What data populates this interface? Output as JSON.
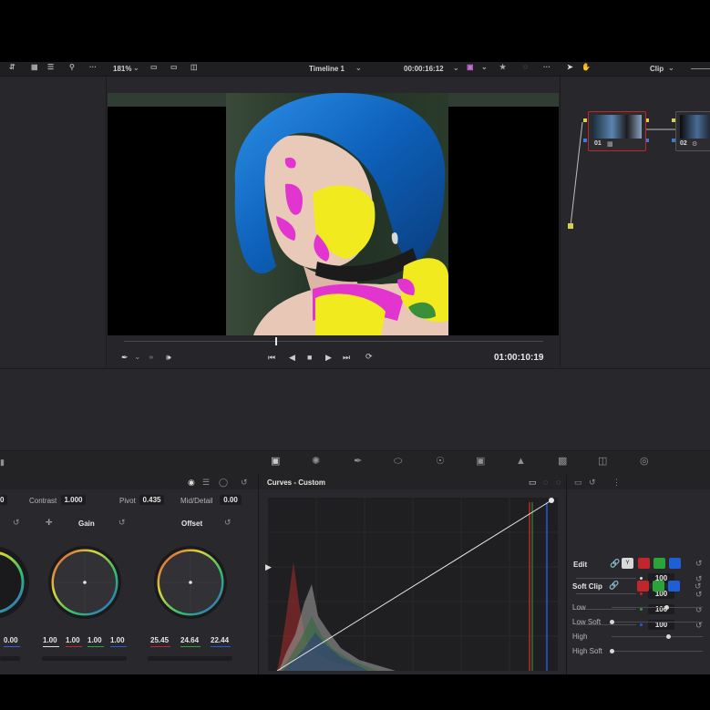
{
  "toolbar": {
    "zoom": "181%",
    "timeline_name": "Timeline 1",
    "timecode": "00:00:16:12",
    "mode": "Clip",
    "more_glyph": "···"
  },
  "viewer": {
    "timecode": "01:00:10:19",
    "playhead_fraction": 0.36
  },
  "nodes": [
    {
      "label": "01"
    },
    {
      "label": "02"
    }
  ],
  "primaries": {
    "contrast_label": "Contrast",
    "contrast_value": "1.000",
    "pivot_label": "Pivot",
    "pivot_value": "0.435",
    "middetail_label": "Mid/Detail",
    "middetail_value": "0.00",
    "left_box_value": "0",
    "gain_title": "Gain",
    "offset_title": "Offset",
    "left_wheel_value": "0.00",
    "gain_values": [
      "1.00",
      "1.00",
      "1.00",
      "1.00"
    ],
    "offset_values": [
      "25.45",
      "24.64",
      "22.44"
    ]
  },
  "curves": {
    "title": "Curves - Custom"
  },
  "edit": {
    "title": "Edit",
    "channels": [
      "Y",
      "R",
      "G",
      "B"
    ],
    "values": [
      "100",
      "100",
      "100",
      "100"
    ],
    "softclip_title": "Soft Clip",
    "softclip_channels": [
      "R",
      "G",
      "B"
    ],
    "softclip_rows": [
      "Low",
      "Low Soft",
      "High",
      "High Soft"
    ],
    "softclip_levels": [
      0.6,
      0.0,
      0.62,
      0.0
    ]
  },
  "colors": {
    "accent_red": "#c0262a",
    "accent_green": "#2aa33a",
    "accent_blue": "#1f5fd6",
    "node_outline": "#c0262a",
    "connector": "#d6d04a"
  }
}
